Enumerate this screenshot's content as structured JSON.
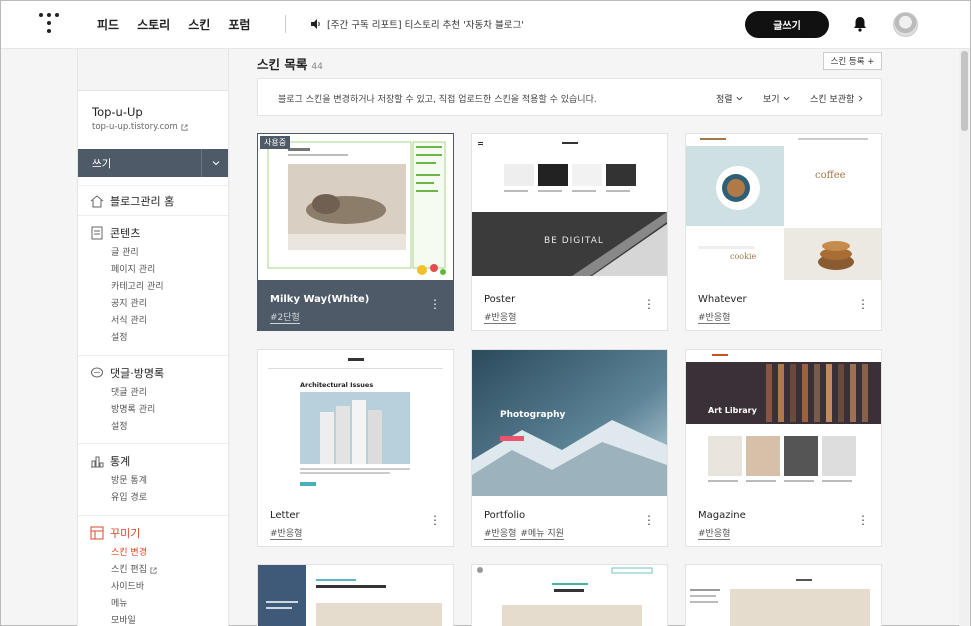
{
  "topbar": {
    "nav": [
      "피드",
      "스토리",
      "스킨",
      "포럼"
    ],
    "notice": "[주간 구독 리포트] 티스토리 추천 '자동차 블로그'",
    "write_button": "글쓰기"
  },
  "sidebar": {
    "blog_name": "Top-u-Up",
    "blog_url": "top-u-up.tistory.com",
    "write_label": "쓰기",
    "home_label": "블로그관리 홈",
    "sections": [
      {
        "title": "콘텐츠",
        "items": [
          "글 관리",
          "페이지 관리",
          "카테고리 관리",
          "공지 관리",
          "서식 관리",
          "설정"
        ]
      },
      {
        "title": "댓글·방명록",
        "items": [
          "댓글 관리",
          "방명록 관리",
          "설정"
        ]
      },
      {
        "title": "통계",
        "items": [
          "방문 통계",
          "유입 경로"
        ]
      },
      {
        "title": "꾸미기",
        "items": [
          "스킨 변경",
          "스킨 편집",
          "사이드바",
          "메뉴",
          "모바일"
        ]
      }
    ]
  },
  "main": {
    "title": "스킨 목록",
    "count": "44",
    "register_button": "스킨 등록 +",
    "info_text": "블로그 스킨을 변경하거나 저장할 수 있고, 직접 업로드한 스킨을 적용할 수 있습니다.",
    "sort_label": "정렬",
    "view_label": "보기",
    "storage_label": "스킨 보관함"
  },
  "skins": [
    {
      "name": "Milky Way(White)",
      "tags": [
        "#2단형"
      ],
      "badge": "사용중",
      "thumb_text": ""
    },
    {
      "name": "Poster",
      "tags": [
        "#반응형"
      ],
      "thumb_text": "BE DIGITAL"
    },
    {
      "name": "Whatever",
      "tags": [
        "#반응형"
      ],
      "thumb_text": "coffee"
    },
    {
      "name": "Letter",
      "tags": [
        "#반응형"
      ],
      "thumb_text": "Architectural Issues"
    },
    {
      "name": "Portfolio",
      "tags": [
        "#반응형",
        "#메뉴 지원"
      ],
      "thumb_text": "Photography"
    },
    {
      "name": "Magazine",
      "tags": [
        "#반응형"
      ],
      "thumb_text": "Art Library"
    }
  ],
  "colors": {
    "accent": "#d9482b",
    "active_card": "#4e5a67"
  }
}
